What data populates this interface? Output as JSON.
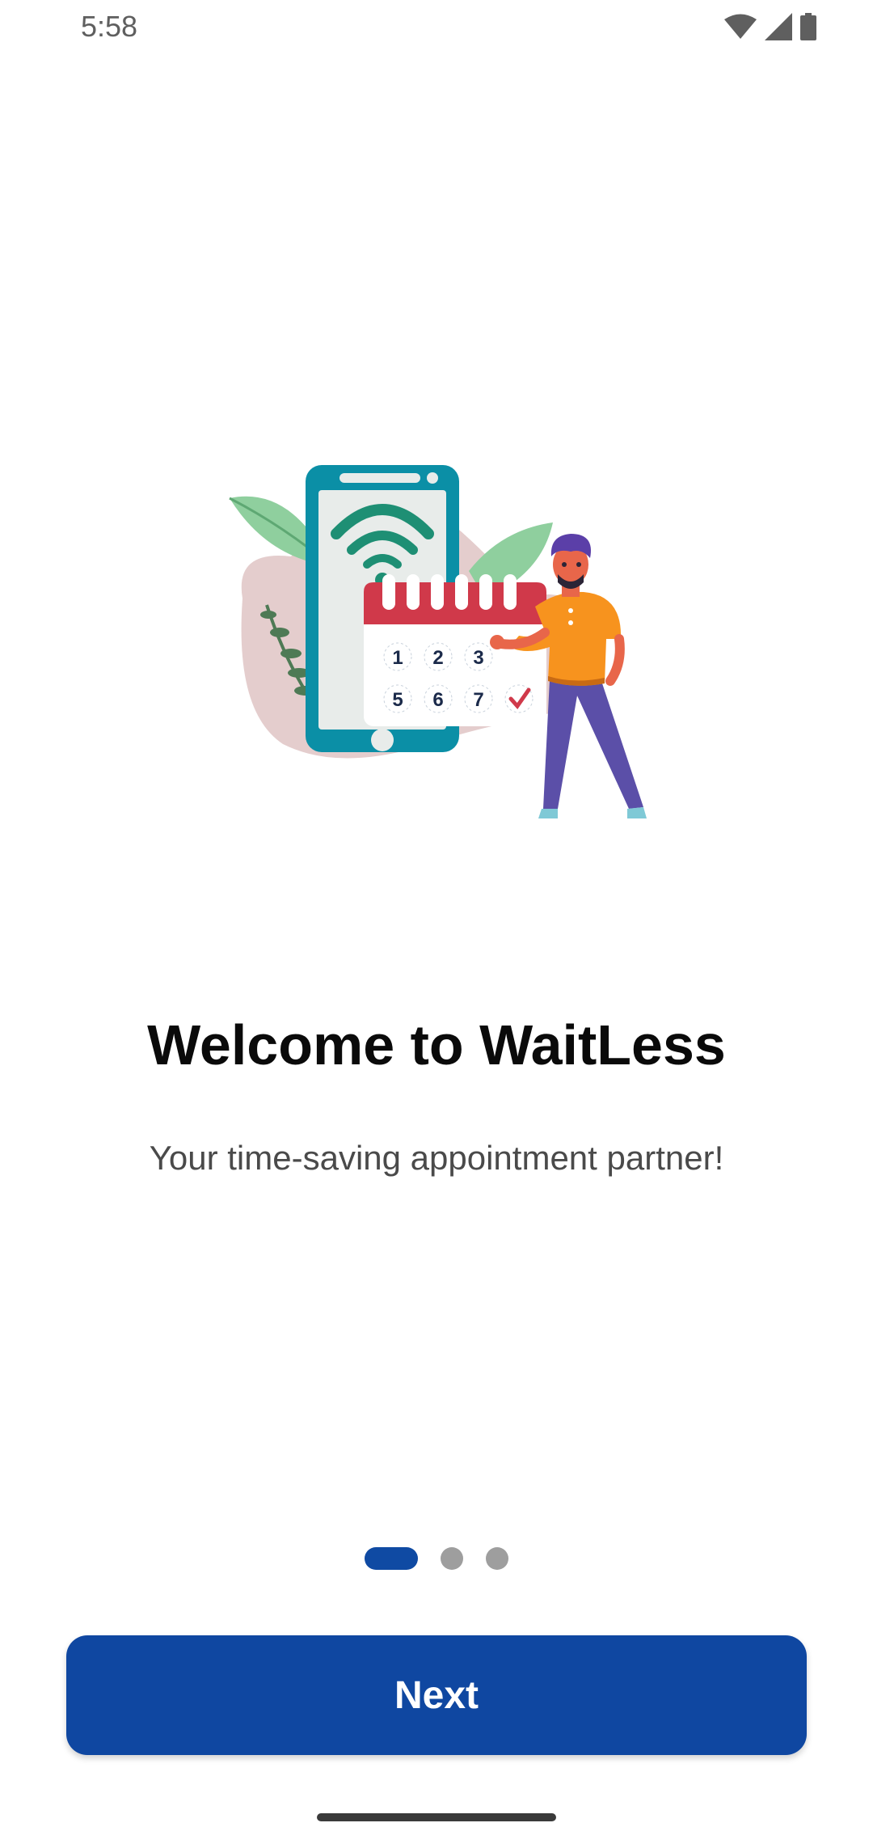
{
  "status_bar": {
    "time": "5:58",
    "icons": [
      "wifi-icon",
      "cellular-signal-icon",
      "battery-icon"
    ]
  },
  "illustration": {
    "name": "phone-calendar-person-illustration",
    "calendar_numbers": [
      "1",
      "2",
      "3",
      "5",
      "6",
      "7"
    ]
  },
  "onboarding": {
    "title": "Welcome to WaitLess",
    "subtitle": "Your time-saving appointment partner!",
    "page_indicator": {
      "current": 1,
      "total": 3
    }
  },
  "actions": {
    "next_label": "Next"
  },
  "colors": {
    "primary": "#0f47a1",
    "indicator_inactive": "#9e9e9e",
    "title": "#0a0a0a",
    "subtitle": "#4a4a4a"
  }
}
